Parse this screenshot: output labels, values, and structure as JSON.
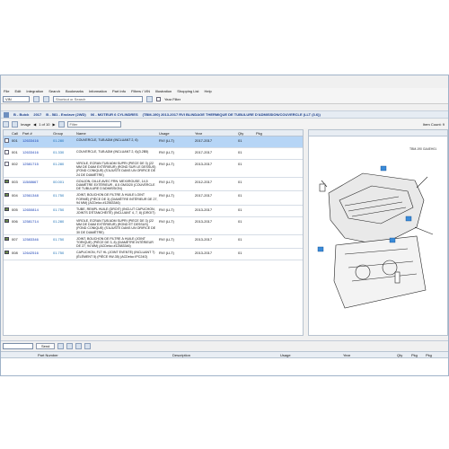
{
  "menu": [
    "File",
    "Edit",
    "Integration",
    "Search",
    "Bookmarks",
    "Information",
    "Part Info",
    "Filters / VIN",
    "Illustration",
    "Shopping List",
    "Help"
  ],
  "toolbar": {
    "vin_label": "VIN",
    "search_placeholder": "Shortcut or Search",
    "year_filter": "Year Filter"
  },
  "breadcrumb": [
    "B - Buick",
    "2017",
    "B - 581 - Enclave (2WD)",
    "06 - MOTEUR 6 CYLINDRES",
    "(TBM-190)  2013-2017  RVI BLINDAGE THERMIQUE DE TUBULURE D'ADMISSION/COUVERCLE (LLT (3.6))"
  ],
  "subtoolbar": {
    "image_label": "Image",
    "image_counter": "1 of 10",
    "filter_placeholder": "Filter",
    "items_count": "Item Count: 9"
  },
  "table": {
    "headers": [
      "",
      "Call",
      "Part #",
      "Group",
      "Name",
      "Usage",
      "Year",
      "Qty",
      "Pkg"
    ],
    "rows": [
      {
        "call": "001",
        "part": "12633416",
        "group": "01.280",
        "name": "COUVERCLE, TUB ADM (INCLUANT 2, 6)",
        "usage": "RVI (LLT)",
        "year": "2017-2017",
        "qty": "01",
        "pkg": "",
        "selected": true
      },
      {
        "call": "001",
        "part": "12633416",
        "group": "01.330",
        "name": "COUVERCLE, TUB ADM (INCLUANT 2, 6)(3.2B5)",
        "usage": "RVI (LLT)",
        "year": "2017-2017",
        "qty": "01",
        "pkg": "",
        "selected": false
      },
      {
        "call": "002",
        "part": "12581715",
        "group": "01.280",
        "name": "VIROLE, ÉCRAN TUB ADM SUPRI (PIÈCE DE 3) (22 MM DE DIAM EXTÉRIEUR) (ROND SUR LE DESSUS) (FOND CONIQUE) (S'AJUSTE DANS UN ORIFICE DE 24 DE DIAMÈTRE)",
        "usage": "RVI (LLT)",
        "year": "2013-2017",
        "qty": "01",
        "pkg": "",
        "selected": false
      },
      {
        "call": "003",
        "part": "11588667",
        "group": "00.001",
        "name": "GOUJON, DILLE AVEC FRN. MEXI/ROUSE, 14,5 DIAMÈTRE EXTÉRIEUR , 8.5 GM/3/20 (COUVERCLE DE TUBULURE D'ADMISSION)",
        "usage": "RVI (LLT)",
        "year": "2012-2017",
        "qty": "01",
        "pkg": "",
        "selected": false
      },
      {
        "call": "004",
        "part": "12561348",
        "group": "01.750",
        "name": "JOINT, BOUCHON DE FILTRE À HUILE LOINT FORMÉ) (PIÈCE DE 3) (DIAMÈTRE INTÉRIEUR DE 27, 94 MM) (ACDelco #12563346)",
        "usage": "RVI (LLT)",
        "year": "2017-2017",
        "qty": "01",
        "pkg": "",
        "selected": false
      },
      {
        "call": "005",
        "part": "12650814",
        "group": "01.750",
        "name": "TUBE, REMPL HUILE (DROIT) (INCLUT CAPUCHON, JOINTS D'ÉTANCHÉITÉ) (INCLUANT 4, 7, 8) (DROIT)",
        "usage": "RVI (LLT)",
        "year": "2013-2017",
        "qty": "01",
        "pkg": "",
        "selected": false
      },
      {
        "call": "006",
        "part": "12581714",
        "group": "01.280",
        "name": "VIROLE, ÉCRAN TUB ADM SUPRI (PIÈCE DE 3) (22 MM DE DIAM EXTÉRIEUR) (ROND ET DESSUS) (FOND CONIQUE) (S'AJUSTE DANS UN ORIFICE DE 30 DE DIAMÈTRE)",
        "usage": "RVI (LLT)",
        "year": "2013-2017",
        "qty": "01",
        "pkg": "",
        "selected": false
      },
      {
        "call": "007",
        "part": "12583346",
        "group": "01.750",
        "name": "JOINT, BOUCHON DE FILTRE À HUILE (JOINT TORIQUE) (PIÈCE DE 3, 8) (DIAMÈTRE INTÉRIEUR DE 27, 94 MM) (ACDelco #12583346)",
        "usage": "RVI (LLT)",
        "year": "2013-2017",
        "qty": "01",
        "pkg": "",
        "selected": false
      },
      {
        "call": "008",
        "part": "12642516",
        "group": "01.750",
        "name": "CAPUCHON, FLT HL (JOINT ÉVENTÉ) (INCLUANT 7) (ÉLÉMENT 5) (PIÈCE 9W-35) (ACDelco IPC24O)",
        "usage": "RVI (LLT)",
        "year": "2013-2017",
        "qty": "01",
        "pkg": "",
        "selected": false
      }
    ]
  },
  "figure": {
    "id_text": "TBM-190 GA4EH01"
  },
  "bottom": {
    "send_label": "Send",
    "headers": [
      "",
      "Part Number",
      "Description",
      "Usage",
      "Year",
      "Qty",
      "Pkg",
      "Pkg"
    ]
  }
}
